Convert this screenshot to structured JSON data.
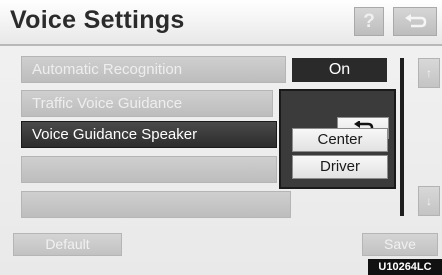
{
  "header": {
    "title": "Voice Settings",
    "help_label": "?"
  },
  "settings": {
    "rows": [
      {
        "label": "Automatic Recognition",
        "value": "On"
      },
      {
        "label": "Traffic Voice Guidance"
      },
      {
        "label": "Voice Guidance Speaker"
      }
    ]
  },
  "popup": {
    "options": [
      {
        "label": "Center"
      },
      {
        "label": "Driver"
      }
    ]
  },
  "footer": {
    "default_label": "Default",
    "save_label": "Save",
    "code": "U10264LC"
  },
  "icons": {
    "back": "return-arrow-icon",
    "scroll_up": "scroll-up-icon",
    "scroll_down": "scroll-down-icon"
  },
  "colors": {
    "selected_row": "#2c2c2c",
    "disabled_row": "#c6c6c6",
    "popup_bg": "#3b3b3b"
  }
}
